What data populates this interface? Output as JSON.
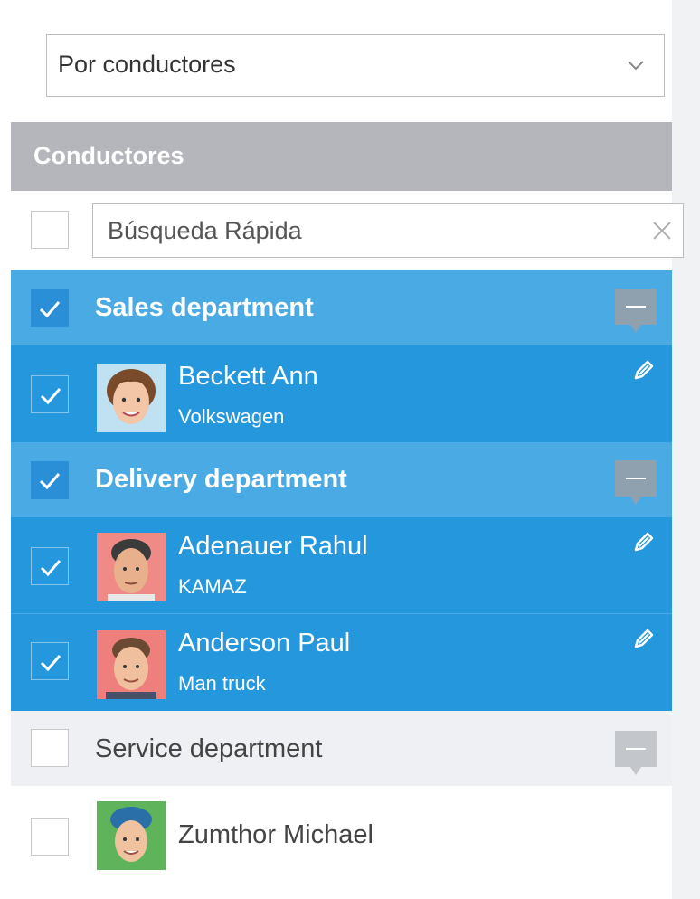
{
  "filter": {
    "selected": "Por conductores"
  },
  "panel": {
    "title": "Conductores"
  },
  "search": {
    "placeholder": "Búsqueda Rápida"
  },
  "groups": [
    {
      "name": "Sales department",
      "checked": true,
      "drivers": [
        {
          "name": "Beckett Ann",
          "vehicle": "Volkswagen",
          "checked": true
        }
      ]
    },
    {
      "name": "Delivery department",
      "checked": true,
      "drivers": [
        {
          "name": "Adenauer Rahul",
          "vehicle": "KAMAZ",
          "checked": true
        },
        {
          "name": "Anderson Paul",
          "vehicle": "Man truck",
          "checked": true
        }
      ]
    },
    {
      "name": "Service department",
      "checked": false,
      "drivers": [
        {
          "name": "Zumthor Michael",
          "vehicle": "",
          "checked": false
        }
      ]
    }
  ],
  "colors": {
    "header": "#b4b6bc",
    "group_selected": "#4aaae4",
    "item_selected": "#2598dd",
    "group_unselected": "#eef0f3"
  },
  "icons": {
    "dropdown": "chevron-down-icon",
    "clear": "close-icon",
    "checkbox": "checkmark-icon",
    "collapse": "minus-icon",
    "edit": "pencil-icon"
  }
}
